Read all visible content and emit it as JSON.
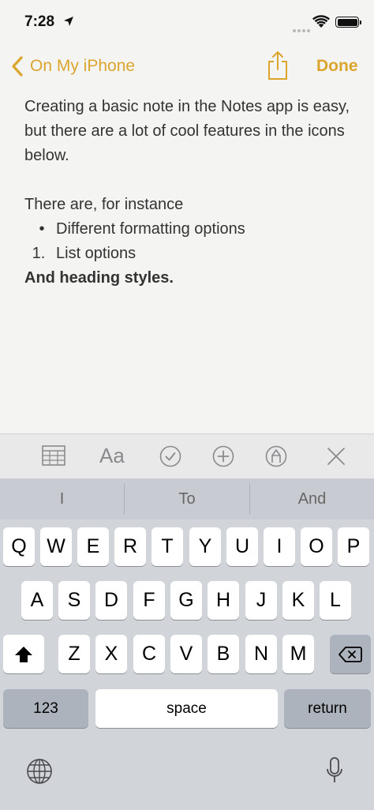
{
  "status": {
    "time": "7:28"
  },
  "nav": {
    "back_label": "On My iPhone",
    "done_label": "Done"
  },
  "note": {
    "paragraph1": "Creating a basic note in the Notes app is easy, but there are a lot of cool features in the icons below.",
    "paragraph2": "There are, for instance",
    "bullet_marker": "•",
    "bullet_item": "Different formatting options",
    "number_marker": "1.",
    "numbered_item": "List options",
    "heading": "And heading styles."
  },
  "toolbar": {
    "format_label": "Aa"
  },
  "suggestions": [
    "I",
    "To",
    "And"
  ],
  "keys": {
    "row1": [
      "Q",
      "W",
      "E",
      "R",
      "T",
      "Y",
      "U",
      "I",
      "O",
      "P"
    ],
    "row2": [
      "A",
      "S",
      "D",
      "F",
      "G",
      "H",
      "J",
      "K",
      "L"
    ],
    "row3": [
      "Z",
      "X",
      "C",
      "V",
      "B",
      "N",
      "M"
    ],
    "numbers": "123",
    "space": "space",
    "return": "return"
  },
  "colors": {
    "accent": "#dba52e",
    "icon_gray": "#8a8a8e"
  },
  "icons": [
    "location-arrow-icon",
    "wifi-icon",
    "battery-icon",
    "chevron-left-icon",
    "share-icon",
    "table-icon",
    "checklist-icon",
    "add-icon",
    "markup-icon",
    "close-icon",
    "shift-icon",
    "delete-icon",
    "globe-icon",
    "microphone-icon"
  ]
}
